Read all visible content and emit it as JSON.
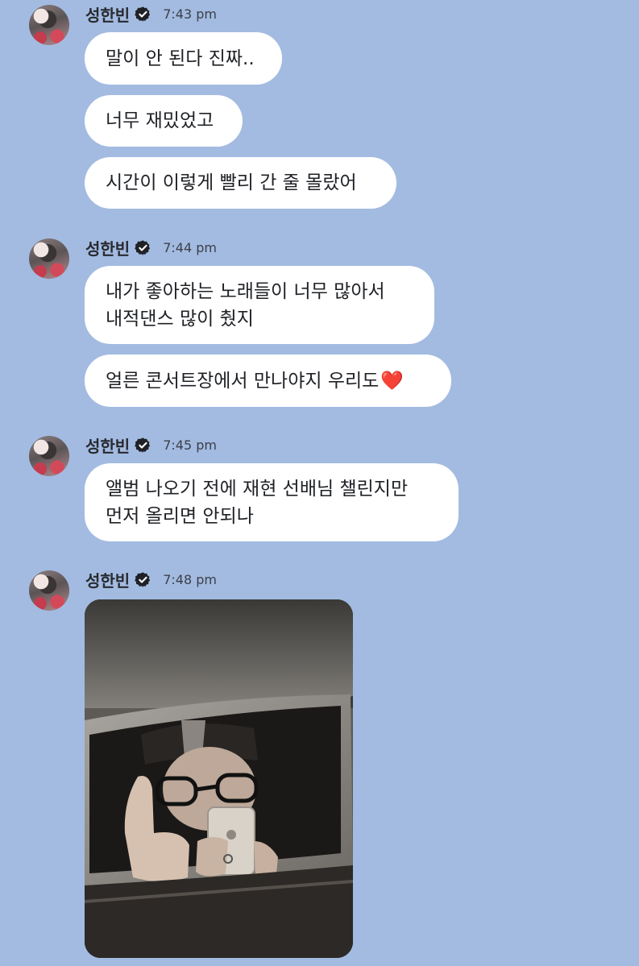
{
  "theme": {
    "background": "#a3bbe1",
    "bubble": "#ffffff",
    "verified_badge": "#1f2126",
    "heart": "#e0242e"
  },
  "groups": [
    {
      "sender": "성한빈",
      "time": "7:43 pm",
      "avatar_icon": "avatar-photo-icon",
      "badge_icon": "verified-badge-icon",
      "messages": [
        "말이 안 된다 진짜..",
        "너무 재밌었고",
        "시간이 이렇게 빨리 간 줄 몰랐어"
      ]
    },
    {
      "sender": "성한빈",
      "time": "7:44 pm",
      "avatar_icon": "avatar-photo-icon",
      "badge_icon": "verified-badge-icon",
      "messages": [
        "내가 좋아하는 노래들이 너무 많아서\n내적댄스 많이 췄지",
        "얼른 콘서트장에서 만나야지 우리도"
      ],
      "emoji": "❤️"
    },
    {
      "sender": "성한빈",
      "time": "7:45 pm",
      "avatar_icon": "avatar-photo-icon",
      "badge_icon": "verified-badge-icon",
      "messages": [
        "앨범 나오기 전에 재현 선배님 챌린지만\n먼저 올리면 안되나"
      ]
    },
    {
      "sender": "성한빈",
      "time": "7:48 pm",
      "avatar_icon": "avatar-photo-icon",
      "badge_icon": "verified-badge-icon",
      "attachment": {
        "type": "photo",
        "icon": "mirror-selfie-photo-icon"
      }
    }
  ]
}
